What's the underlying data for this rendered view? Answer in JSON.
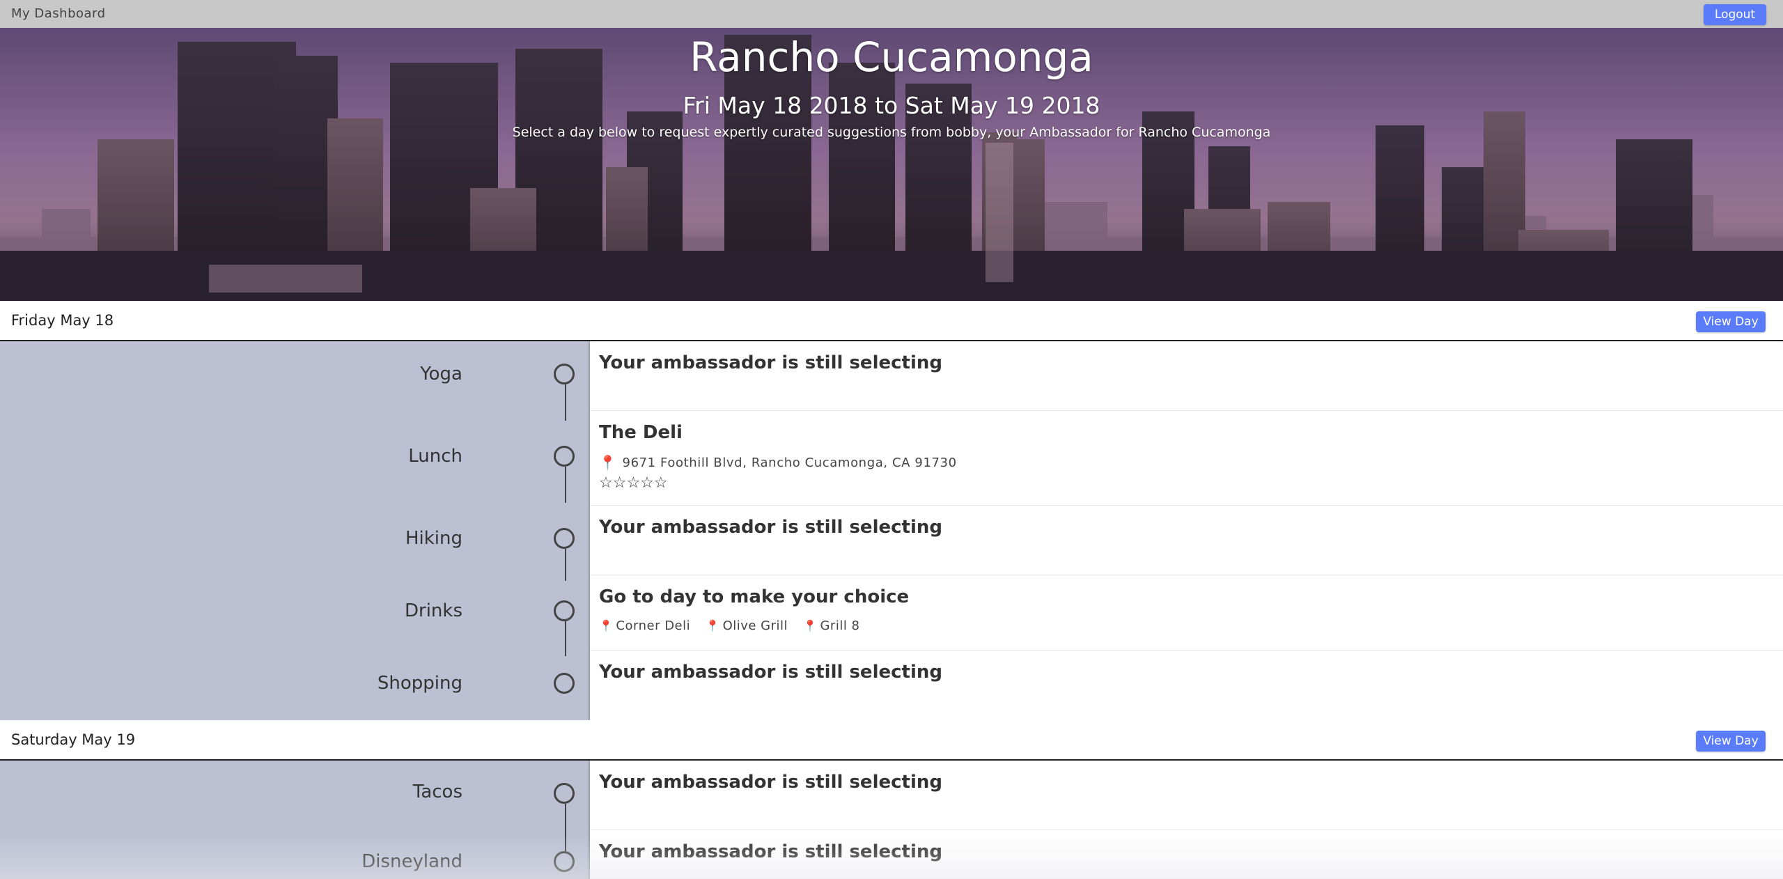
{
  "topbar": {
    "brand": "My Dashboard",
    "logout_label": "Logout"
  },
  "hero": {
    "title": "Rancho Cucamonga",
    "dates": "Fri May 18 2018 to Sat May 19 2018",
    "subtitle": "Select a day below to request expertly curated suggestions from bobby, your Ambassador for Rancho Cucamonga"
  },
  "days": [
    {
      "label": "Friday May 18",
      "view_label": "View Day",
      "items": [
        {
          "category": "Yoga",
          "heading": "Your ambassador is still selecting"
        },
        {
          "category": "Lunch",
          "heading": "The Deli",
          "address": "9671 Foothill Blvd, Rancho Cucamonga, CA 91730",
          "rating": 0,
          "stars": "☆☆☆☆☆"
        },
        {
          "category": "Hiking",
          "heading": "Your ambassador is still selecting"
        },
        {
          "category": "Drinks",
          "heading": "Go to day to make your choice",
          "options": [
            "Corner Deli",
            "Olive Grill",
            "Grill 8"
          ]
        },
        {
          "category": "Shopping",
          "heading": "Your ambassador is still selecting"
        }
      ]
    },
    {
      "label": "Saturday May 19",
      "view_label": "View Day",
      "items": [
        {
          "category": "Tacos",
          "heading": "Your ambassador is still selecting"
        },
        {
          "category": "Disneyland",
          "heading": "Your ambassador is still selecting"
        }
      ]
    }
  ],
  "colors": {
    "accent": "#5b7cfa",
    "timeline_bg": "#bcc0d2",
    "topbar_bg": "#c8c8c8",
    "pin_red": "#d22222"
  }
}
